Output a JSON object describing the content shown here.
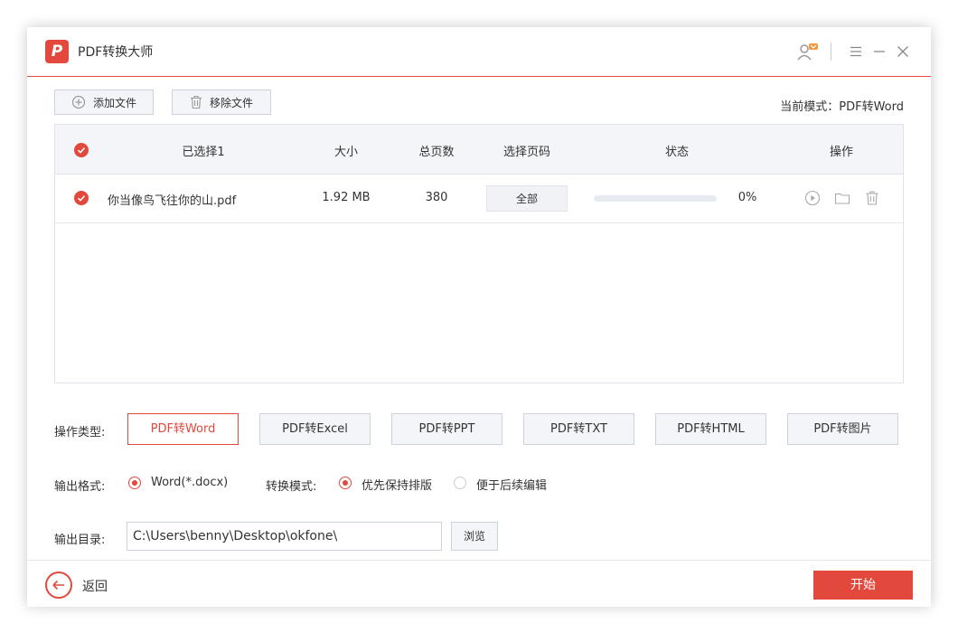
{
  "app": {
    "title": "PDF转换大师",
    "logo_letter": "P",
    "accent_color": "#e2483c"
  },
  "titlebar": {
    "icons": [
      "user-vip-icon",
      "menu-icon",
      "minimize-icon",
      "close-icon"
    ]
  },
  "toolbar": {
    "add_label": "添加文件",
    "remove_label": "移除文件",
    "mode_text": "当前模式：PDF转Word"
  },
  "table": {
    "headers": {
      "selected": "已选择1",
      "size": "大小",
      "pages": "总页数",
      "page_select": "选择页码",
      "status": "状态",
      "actions": "操作"
    },
    "rows": [
      {
        "name": "你当像鸟飞往你的山.pdf",
        "size": "1.92 MB",
        "pages": "380",
        "page_select": "全部",
        "progress_percent": 0,
        "progress_text": "0%",
        "checked": true
      }
    ],
    "row_action_icons": [
      "play-icon",
      "folder-icon",
      "trash-icon"
    ]
  },
  "operation": {
    "label": "操作类型:",
    "types": [
      "PDF转Word",
      "PDF转Excel",
      "PDF转PPT",
      "PDF转TXT",
      "PDF转HTML",
      "PDF转图片"
    ],
    "active_index": 0
  },
  "output_format": {
    "label": "输出格式:",
    "option": "Word(*.docx)",
    "selected": true
  },
  "convert_mode": {
    "label": "转换模式:",
    "options": [
      "优先保持排版",
      "便于后续编辑"
    ],
    "selected_index": 0
  },
  "output_dir": {
    "label": "输出目录:",
    "value": "C:\\Users\\benny\\Desktop\\okfone\\",
    "browse_label": "浏览"
  },
  "footer": {
    "back_label": "返回",
    "start_label": "开始"
  }
}
